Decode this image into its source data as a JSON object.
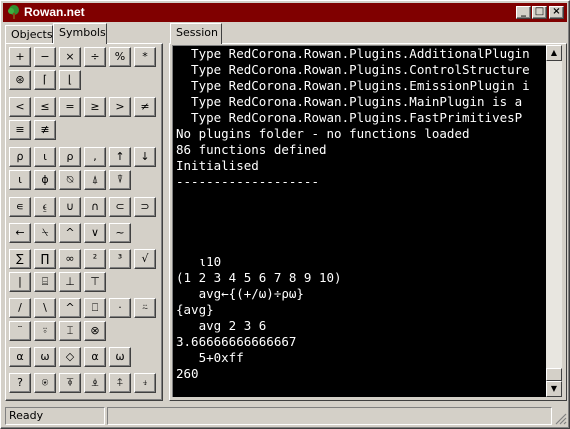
{
  "window": {
    "title": "Rowan.net",
    "icon": "tree-icon",
    "controls": {
      "minimize": "_",
      "maximize": "□",
      "close": "×"
    },
    "title_color": "#800000"
  },
  "left_tabs": [
    "Objects",
    "Symbols"
  ],
  "session_tab": "Session",
  "symbols": {
    "rows": [
      [
        "+",
        "−",
        "×",
        "÷",
        "%",
        "*"
      ],
      [
        "⊛",
        "⌈",
        "⌊"
      ],
      [
        "<",
        "≤",
        "=",
        "≥",
        ">",
        "≠"
      ],
      [
        "≡",
        "≢"
      ],
      [
        "⍴",
        "⍳",
        "ρ",
        ",",
        "↑",
        "↓"
      ],
      [
        "⍳",
        "ϕ",
        "⍉",
        "⍋",
        "⍒"
      ],
      [
        "∊",
        "⍷",
        "∪",
        "∩",
        "⊂",
        "⊃"
      ],
      [
        "←",
        "⍀",
        "^",
        "∨",
        "~"
      ],
      [
        "∑",
        "∏",
        "∞",
        "²",
        "³",
        "√"
      ],
      [
        "|",
        "⌸",
        "⊥",
        "⊤"
      ],
      [
        "/",
        "\\",
        "^",
        "⎕",
        "·",
        "⍨"
      ],
      [
        "¨",
        "⍤",
        "⌶",
        "⊗"
      ],
      [
        "α",
        "ω",
        "◇",
        "⍺",
        "⍵"
      ],
      [
        "?",
        "⍟",
        "⍕",
        "⍎",
        "⍏",
        "⍖"
      ]
    ]
  },
  "console": {
    "lines": [
      "  Type RedCorona.Rowan.Plugins.AdditionalPlugin",
      "  Type RedCorona.Rowan.Plugins.ControlStructure",
      "  Type RedCorona.Rowan.Plugins.EmissionPlugin i",
      "  Type RedCorona.Rowan.Plugins.MainPlugin is a",
      "  Type RedCorona.Rowan.Plugins.FastPrimitivesP",
      "No plugins folder - no functions loaded",
      "86 functions defined",
      "Initialised",
      "-------------------",
      "",
      "",
      "",
      "",
      "   ι10",
      "(1 2 3 4 5 6 7 8 9 10)",
      "   avg←{(+/ω)÷ρω}",
      "{avg}",
      "   avg 2 3 6",
      "3.66666666666667",
      "   5+0xff",
      "260"
    ]
  },
  "status": {
    "text": "Ready",
    "second": ""
  }
}
